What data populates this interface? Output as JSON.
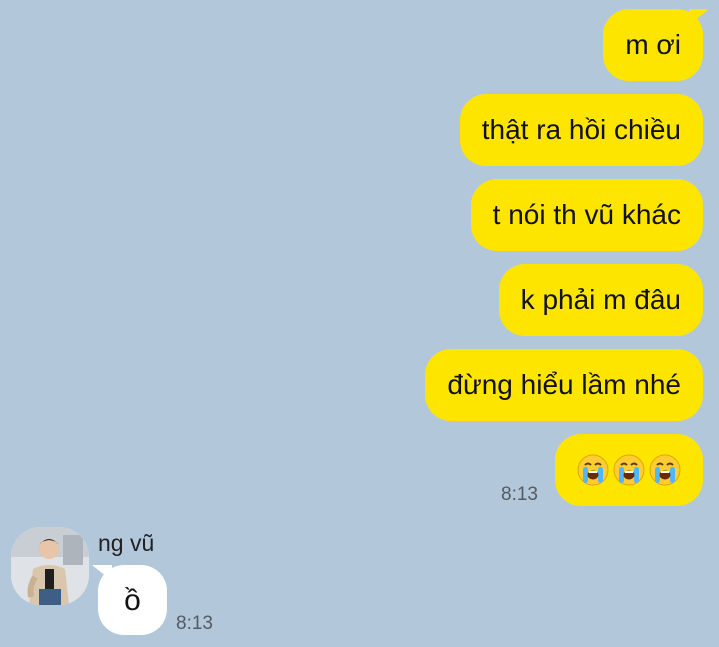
{
  "chat": {
    "outgoing_messages": [
      {
        "text": "m ơi"
      },
      {
        "text": "thật ra hồi chiều"
      },
      {
        "text": "t nói th vũ khác"
      },
      {
        "text": "k phải m đâu"
      },
      {
        "text": "đừng hiểu lầm nhé"
      }
    ],
    "emoji_message": {
      "emojis": [
        "loudly-crying-face",
        "loudly-crying-face",
        "loudly-crying-face"
      ],
      "time": "8:13"
    },
    "incoming": {
      "sender_name": "ng vũ",
      "text": "ồ",
      "time": "8:13"
    }
  },
  "colors": {
    "background": "#b2c7da",
    "outgoing_bubble": "#fee500",
    "incoming_bubble": "#ffffff"
  }
}
